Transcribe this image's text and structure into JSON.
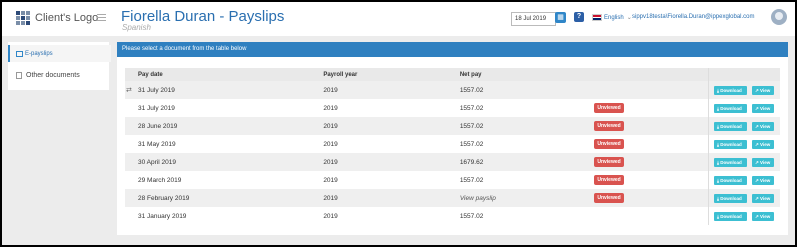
{
  "header": {
    "logo_text": "Client's Logo",
    "title": "Fiorella Duran - Payslips",
    "subtitle": "Spanish",
    "date_value": "18 Jul 2019",
    "help_label": "?",
    "language": "English",
    "user": "sippv18testa\\Fiorella.Duran@ippexglobal.com"
  },
  "sidebar": {
    "items": [
      {
        "label": "E-payslips"
      },
      {
        "label": "Other documents"
      }
    ]
  },
  "main": {
    "banner": "Please select a document from the table below",
    "columns": [
      "Pay date",
      "Payroll year",
      "Net pay"
    ],
    "download_label": "Download",
    "view_label": "View",
    "rows": [
      {
        "pay_date": "31 July 2019",
        "year": "2019",
        "net_pay": "1557.02",
        "badge": ""
      },
      {
        "pay_date": "31 July 2019",
        "year": "2019",
        "net_pay": "1557.02",
        "badge": "Unviewed"
      },
      {
        "pay_date": "28 June 2019",
        "year": "2019",
        "net_pay": "1557.02",
        "badge": "Unviewed"
      },
      {
        "pay_date": "31 May 2019",
        "year": "2019",
        "net_pay": "1557.02",
        "badge": "Unviewed"
      },
      {
        "pay_date": "30 April 2019",
        "year": "2019",
        "net_pay": "1679.62",
        "badge": "Unviewed"
      },
      {
        "pay_date": "29 March 2019",
        "year": "2019",
        "net_pay": "1557.02",
        "badge": "Unviewed"
      },
      {
        "pay_date": "28 February 2019",
        "year": "2019",
        "net_pay": "View payslip",
        "badge": "Unviewed"
      },
      {
        "pay_date": "31 January 2019",
        "year": "2019",
        "net_pay": "1557.02",
        "badge": ""
      }
    ]
  },
  "colors": {
    "accent": "#2f80c0",
    "badge": "#d9534f",
    "action_button": "#3cbfd2"
  }
}
